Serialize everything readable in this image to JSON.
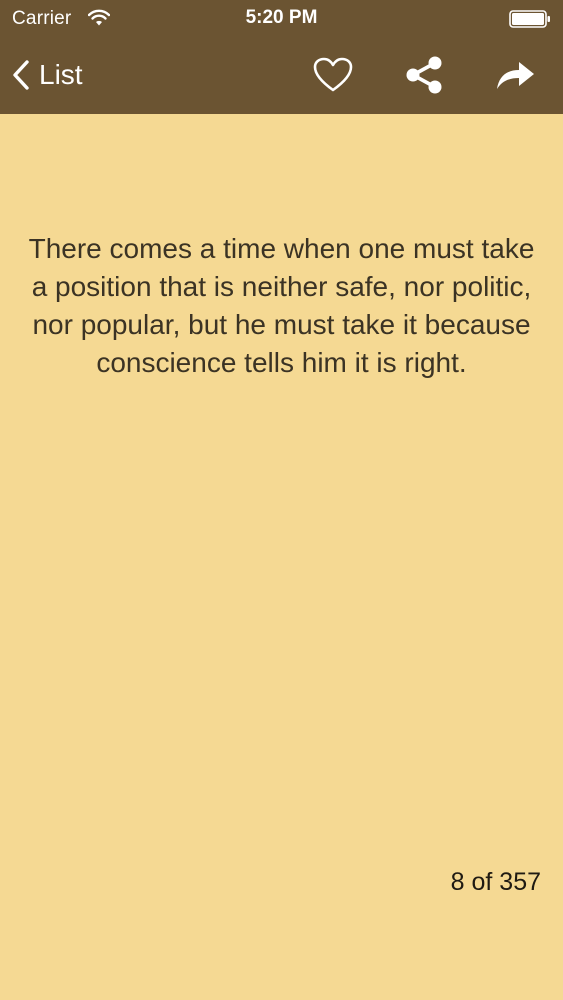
{
  "status_bar": {
    "carrier": "Carrier",
    "time": "5:20 PM",
    "wifi_icon": "wifi-icon",
    "battery_icon": "battery-icon"
  },
  "nav_bar": {
    "back_label": "List",
    "back_icon": "chevron-left-icon",
    "actions": [
      {
        "icon": "heart-icon",
        "label": "favorite"
      },
      {
        "icon": "share-icon",
        "label": "share"
      },
      {
        "icon": "forward-arrow-icon",
        "label": "forward"
      }
    ]
  },
  "quote": {
    "text": "There comes a time when one must take a position that is neither safe, nor politic, nor popular, but he must take it because conscience tells him it is right."
  },
  "counter": {
    "text": "8 of 357"
  },
  "colors": {
    "bar": "#6b5432",
    "background": "#f5d993",
    "text": "#3b3324"
  }
}
